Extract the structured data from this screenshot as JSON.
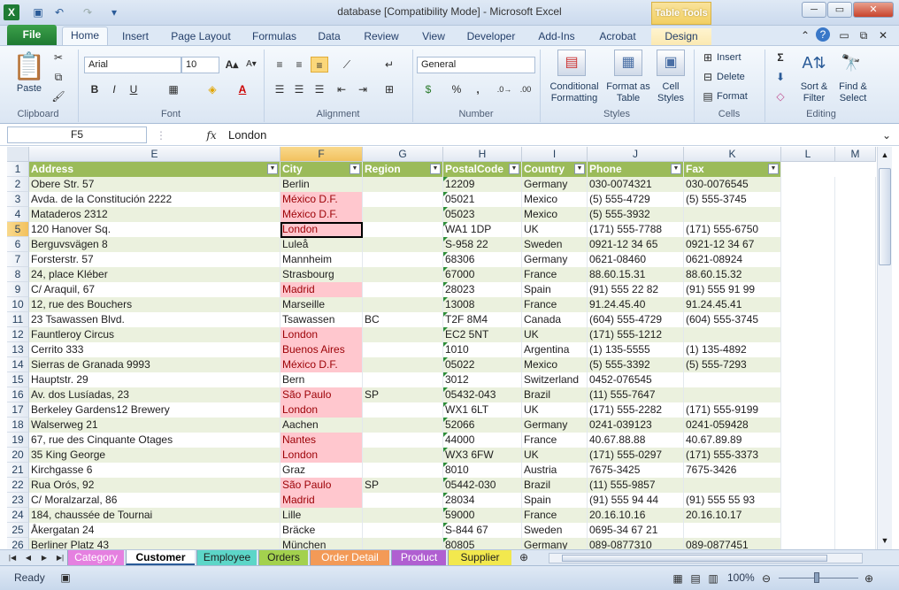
{
  "title_bar": {
    "title": "database  [Compatibility Mode]  -  Microsoft Excel",
    "table_tools": "Table Tools"
  },
  "tabs": {
    "file": "File",
    "items": [
      "Home",
      "Insert",
      "Page Layout",
      "Formulas",
      "Data",
      "Review",
      "View",
      "Developer",
      "Add-Ins",
      "Acrobat",
      "Design"
    ]
  },
  "ribbon": {
    "clipboard": {
      "paste": "Paste",
      "label": "Clipboard"
    },
    "font": {
      "name": "Arial",
      "size": "10",
      "bold": "B",
      "italic": "I",
      "underline": "U",
      "label": "Font"
    },
    "alignment": {
      "label": "Alignment"
    },
    "number": {
      "format": "General",
      "percent": "%",
      "comma": ",",
      "label": "Number"
    },
    "styles": {
      "conditional": "Conditional Formatting",
      "format_table": "Format as Table",
      "cell_styles": "Cell Styles",
      "label": "Styles"
    },
    "cells": {
      "insert": "Insert",
      "delete": "Delete",
      "format": "Format",
      "label": "Cells"
    },
    "editing": {
      "sort": "Sort & Filter",
      "find": "Find & Select",
      "label": "Editing"
    }
  },
  "formula_bar": {
    "name_box": "F5",
    "fx": "fx",
    "value": "London"
  },
  "columns": [
    "E",
    "F",
    "G",
    "H",
    "I",
    "J",
    "K",
    "L",
    "M"
  ],
  "header": [
    "Address",
    "City",
    "Region",
    "PostalCode",
    "Country",
    "Phone",
    "Fax"
  ],
  "rows": [
    {
      "n": "2",
      "a": "Obere Str. 57",
      "c": "Berlin",
      "r": "",
      "p": "12209",
      "co": "Germany",
      "ph": "030-0074321",
      "f": "030-0076545"
    },
    {
      "n": "3",
      "a": "Avda. de la Constitución 2222",
      "c": "México D.F.",
      "r": "",
      "p": "05021",
      "co": "Mexico",
      "ph": "(5) 555-4729",
      "f": "(5) 555-3745"
    },
    {
      "n": "4",
      "a": "Mataderos  2312",
      "c": "México D.F.",
      "r": "",
      "p": "05023",
      "co": "Mexico",
      "ph": "(5) 555-3932",
      "f": ""
    },
    {
      "n": "5",
      "a": "120 Hanover Sq.",
      "c": "London",
      "r": "",
      "p": "WA1 1DP",
      "co": "UK",
      "ph": "(171) 555-7788",
      "f": "(171) 555-6750"
    },
    {
      "n": "6",
      "a": "Berguvsvägen  8",
      "c": "Luleå",
      "r": "",
      "p": "S-958 22",
      "co": "Sweden",
      "ph": "0921-12 34 65",
      "f": "0921-12 34 67"
    },
    {
      "n": "7",
      "a": "Forsterstr. 57",
      "c": "Mannheim",
      "r": "",
      "p": "68306",
      "co": "Germany",
      "ph": "0621-08460",
      "f": "0621-08924"
    },
    {
      "n": "8",
      "a": "24, place Kléber",
      "c": "Strasbourg",
      "r": "",
      "p": "67000",
      "co": "France",
      "ph": "88.60.15.31",
      "f": "88.60.15.32"
    },
    {
      "n": "9",
      "a": "C/ Araquil, 67",
      "c": "Madrid",
      "r": "",
      "p": "28023",
      "co": "Spain",
      "ph": "(91) 555 22 82",
      "f": "(91) 555 91 99"
    },
    {
      "n": "10",
      "a": "12, rue des Bouchers",
      "c": "Marseille",
      "r": "",
      "p": "13008",
      "co": "France",
      "ph": "91.24.45.40",
      "f": "91.24.45.41"
    },
    {
      "n": "11",
      "a": "23 Tsawassen Blvd.",
      "c": "Tsawassen",
      "r": "BC",
      "p": "T2F 8M4",
      "co": "Canada",
      "ph": "(604) 555-4729",
      "f": "(604) 555-3745"
    },
    {
      "n": "12",
      "a": "Fauntleroy Circus",
      "c": "London",
      "r": "",
      "p": "EC2 5NT",
      "co": "UK",
      "ph": "(171) 555-1212",
      "f": ""
    },
    {
      "n": "13",
      "a": "Cerrito 333",
      "c": "Buenos Aires",
      "r": "",
      "p": "1010",
      "co": "Argentina",
      "ph": "(1) 135-5555",
      "f": "(1) 135-4892"
    },
    {
      "n": "14",
      "a": "Sierras de Granada 9993",
      "c": "México D.F.",
      "r": "",
      "p": "05022",
      "co": "Mexico",
      "ph": "(5) 555-3392",
      "f": "(5) 555-7293"
    },
    {
      "n": "15",
      "a": "Hauptstr. 29",
      "c": "Bern",
      "r": "",
      "p": "3012",
      "co": "Switzerland",
      "ph": "0452-076545",
      "f": ""
    },
    {
      "n": "16",
      "a": "Av. dos Lusíadas, 23",
      "c": "São Paulo",
      "r": "SP",
      "p": "05432-043",
      "co": "Brazil",
      "ph": "(11) 555-7647",
      "f": ""
    },
    {
      "n": "17",
      "a": "Berkeley Gardens12  Brewery",
      "c": "London",
      "r": "",
      "p": "WX1 6LT",
      "co": "UK",
      "ph": "(171) 555-2282",
      "f": "(171) 555-9199"
    },
    {
      "n": "18",
      "a": "Walserweg 21",
      "c": "Aachen",
      "r": "",
      "p": "52066",
      "co": "Germany",
      "ph": "0241-039123",
      "f": "0241-059428"
    },
    {
      "n": "19",
      "a": "67, rue des Cinquante Otages",
      "c": "Nantes",
      "r": "",
      "p": "44000",
      "co": "France",
      "ph": "40.67.88.88",
      "f": "40.67.89.89"
    },
    {
      "n": "20",
      "a": "35 King George",
      "c": "London",
      "r": "",
      "p": "WX3 6FW",
      "co": "UK",
      "ph": "(171) 555-0297",
      "f": "(171) 555-3373"
    },
    {
      "n": "21",
      "a": "Kirchgasse 6",
      "c": "Graz",
      "r": "",
      "p": "8010",
      "co": "Austria",
      "ph": "7675-3425",
      "f": "7675-3426"
    },
    {
      "n": "22",
      "a": "Rua Orós, 92",
      "c": "São Paulo",
      "r": "SP",
      "p": "05442-030",
      "co": "Brazil",
      "ph": "(11) 555-9857",
      "f": ""
    },
    {
      "n": "23",
      "a": "C/ Moralzarzal, 86",
      "c": "Madrid",
      "r": "",
      "p": "28034",
      "co": "Spain",
      "ph": "(91) 555 94 44",
      "f": "(91) 555 55 93"
    },
    {
      "n": "24",
      "a": "184, chaussée de Tournai",
      "c": "Lille",
      "r": "",
      "p": "59000",
      "co": "France",
      "ph": "20.16.10.16",
      "f": "20.16.10.17"
    },
    {
      "n": "25",
      "a": "Åkergatan 24",
      "c": "Bräcke",
      "r": "",
      "p": "S-844 67",
      "co": "Sweden",
      "ph": "0695-34 67 21",
      "f": ""
    },
    {
      "n": "26",
      "a": "Berliner Platz 43",
      "c": "München",
      "r": "",
      "p": "80805",
      "co": "Germany",
      "ph": "089-0877310",
      "f": "089-0877451"
    }
  ],
  "sheets": [
    {
      "name": "Category",
      "color": "#e580e0"
    },
    {
      "name": "Customer",
      "color": "#ffffff"
    },
    {
      "name": "Employee",
      "color": "#5dd6c8"
    },
    {
      "name": "Orders",
      "color": "#a3d14e"
    },
    {
      "name": "Order  Detail",
      "color": "#f39a57"
    },
    {
      "name": "Product",
      "color": "#b05fd1"
    },
    {
      "name": "Supplier",
      "color": "#f2e84e"
    }
  ],
  "status": {
    "ready": "Ready",
    "zoom": "100%"
  }
}
